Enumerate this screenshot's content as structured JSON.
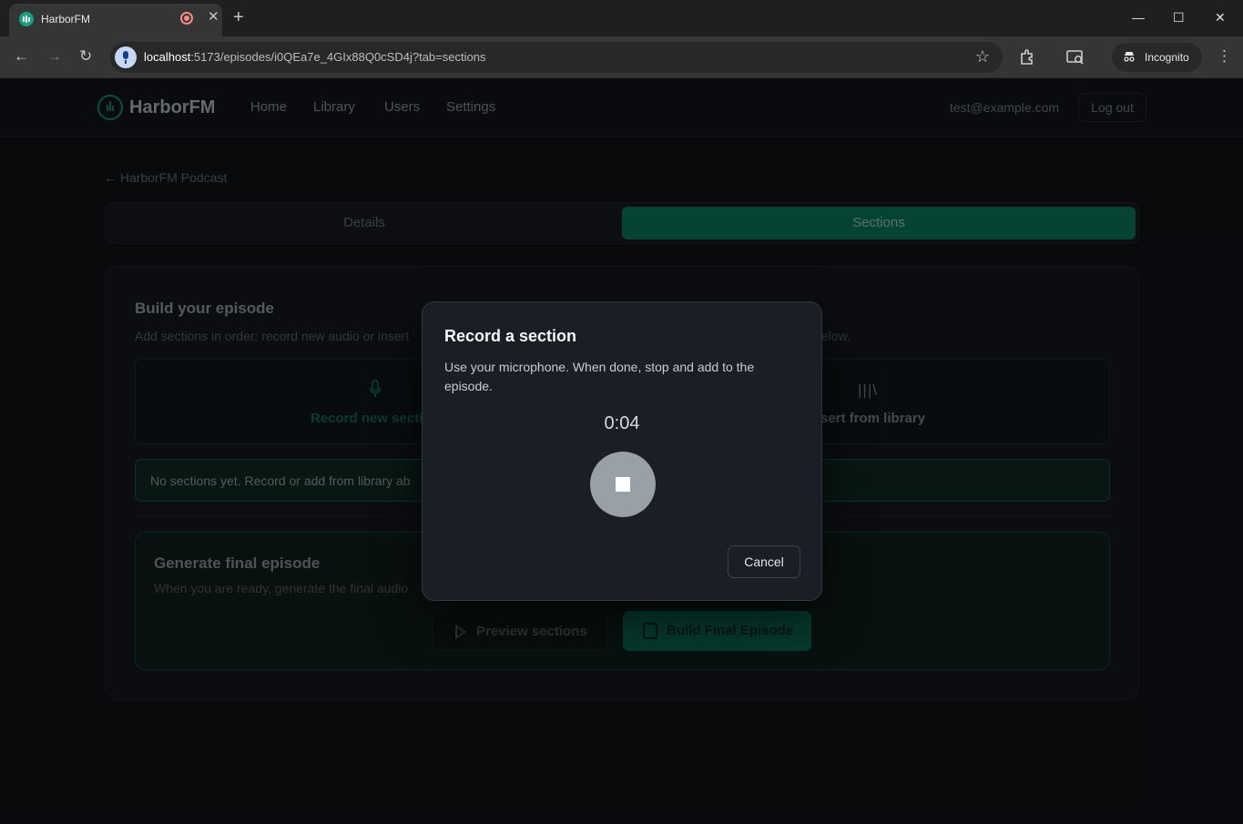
{
  "browser": {
    "tab_title": "HarborFM",
    "url_host": "localhost",
    "url_path": ":5173/episodes/i0QEa7e_4GIx88Q0cSD4j?tab=sections",
    "incognito_label": "Incognito",
    "new_tab_symbol": "+",
    "tab_close_symbol": "✕",
    "back_symbol": "←",
    "forward_symbol": "→",
    "reload_symbol": "↻",
    "star_symbol": "☆",
    "minimize_symbol": "—",
    "maximize_symbol": "☐",
    "window_close_symbol": "✕",
    "menu_symbol": "⋮"
  },
  "header": {
    "brand": "HarborFM",
    "nav": [
      "Home",
      "Library",
      "Users",
      "Settings"
    ],
    "user_email": "test@example.com",
    "logout_label": "Log out"
  },
  "page": {
    "back_link": "← HarborFM Podcast",
    "tabs": [
      "Details",
      "Sections"
    ],
    "active_tab": "Sections"
  },
  "builder": {
    "title": "Build your episode",
    "subtitle": "Add sections in order: record new audio or insert",
    "subtitle_tail": "elow.",
    "record_label": "Record new secti",
    "library_label": "sert from library",
    "empty_note": "No sections yet. Record or add from library ab"
  },
  "generate": {
    "title": "Generate final episode",
    "subtitle": "When you are ready, generate the final audio",
    "preview_label": "Preview sections",
    "build_label": "Build Final Episode"
  },
  "modal": {
    "title": "Record a section",
    "description": "Use your microphone. When done, stop and add to the episode.",
    "timer": "0:04",
    "cancel_label": "Cancel"
  },
  "colors": {
    "accent": "#0b7a5e",
    "modal_bg": "#1b1f25",
    "stop_button": "#9aa0a8"
  },
  "icons": {
    "favicon": "harborfm-logo-icon",
    "recording_indicator": "recording-icon",
    "microphone": "microphone-icon",
    "library": "library-icon",
    "play": "play-icon",
    "build": "headphones-icon",
    "stop": "stop-icon"
  }
}
